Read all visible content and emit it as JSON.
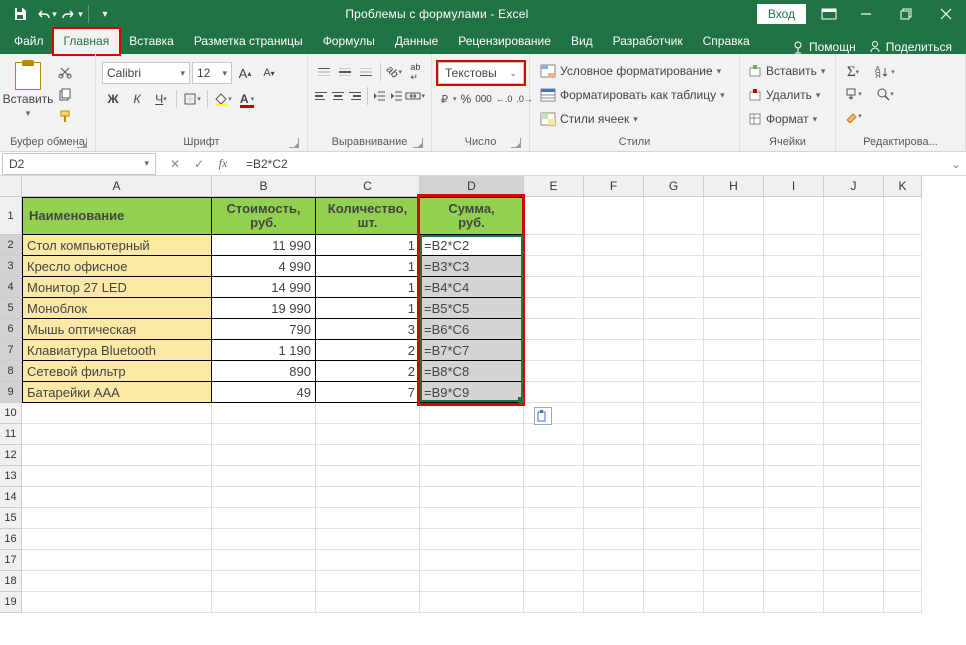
{
  "title": "Проблемы с формулами  -  Excel",
  "login": "Вход",
  "tabs": {
    "file": "Файл",
    "home": "Главная",
    "insert": "Вставка",
    "layout": "Разметка страницы",
    "formulas": "Формулы",
    "data": "Данные",
    "review": "Рецензирование",
    "view": "Вид",
    "developer": "Разработчик",
    "help": "Справка",
    "assist": "Помощн",
    "share": "Поделиться"
  },
  "ribbon": {
    "clipboard": {
      "paste": "Вставить",
      "label": "Буфер обмена"
    },
    "font": {
      "name": "Calibri",
      "size": "12",
      "label": "Шрифт"
    },
    "align": {
      "label": "Выравнивание"
    },
    "number": {
      "format": "Текстовы",
      "label": "Число"
    },
    "styles": {
      "cond": "Условное форматирование",
      "table": "Форматировать как таблицу",
      "cell": "Стили ячеек",
      "label": "Стили"
    },
    "cells": {
      "insert": "Вставить",
      "delete": "Удалить",
      "format": "Формат",
      "label": "Ячейки"
    },
    "editing": {
      "label": "Редактирова..."
    }
  },
  "namebox": "D2",
  "formula": "=B2*C2",
  "colWidths": {
    "A": 190,
    "B": 104,
    "C": 104,
    "D": 104,
    "E": 60,
    "F": 60,
    "G": 60,
    "H": 60,
    "I": 60,
    "J": 60,
    "K": 38
  },
  "colLetters": [
    "A",
    "B",
    "C",
    "D",
    "E",
    "F",
    "G",
    "H",
    "I",
    "J",
    "K"
  ],
  "rowHeights": {
    "header": 38,
    "data": 21
  },
  "headers": {
    "A": "Наименование",
    "B": "Стоимость, руб.",
    "C": "Количество, шт.",
    "D": "Сумма, руб."
  },
  "rows": [
    {
      "n": 2,
      "A": "Стол компьютерный",
      "B": "11 990",
      "C": "1",
      "D": "=B2*C2"
    },
    {
      "n": 3,
      "A": "Кресло офисное",
      "B": "4 990",
      "C": "1",
      "D": "=B3*C3"
    },
    {
      "n": 4,
      "A": "Монитор 27 LED",
      "B": "14 990",
      "C": "1",
      "D": "=B4*C4"
    },
    {
      "n": 5,
      "A": "Моноблок",
      "B": "19 990",
      "C": "1",
      "D": "=B5*C5"
    },
    {
      "n": 6,
      "A": "Мышь оптическая",
      "B": "790",
      "C": "3",
      "D": "=B6*C6"
    },
    {
      "n": 7,
      "A": "Клавиатура Bluetooth",
      "B": "1 190",
      "C": "2",
      "D": "=B7*C7"
    },
    {
      "n": 8,
      "A": "Сетевой фильтр",
      "B": "890",
      "C": "2",
      "D": "=B8*C8"
    },
    {
      "n": 9,
      "A": "Батарейки AAA",
      "B": "49",
      "C": "7",
      "D": "=B9*C9"
    }
  ],
  "emptyRows": [
    10,
    11,
    12,
    13,
    14,
    15,
    16,
    17,
    18,
    19
  ]
}
